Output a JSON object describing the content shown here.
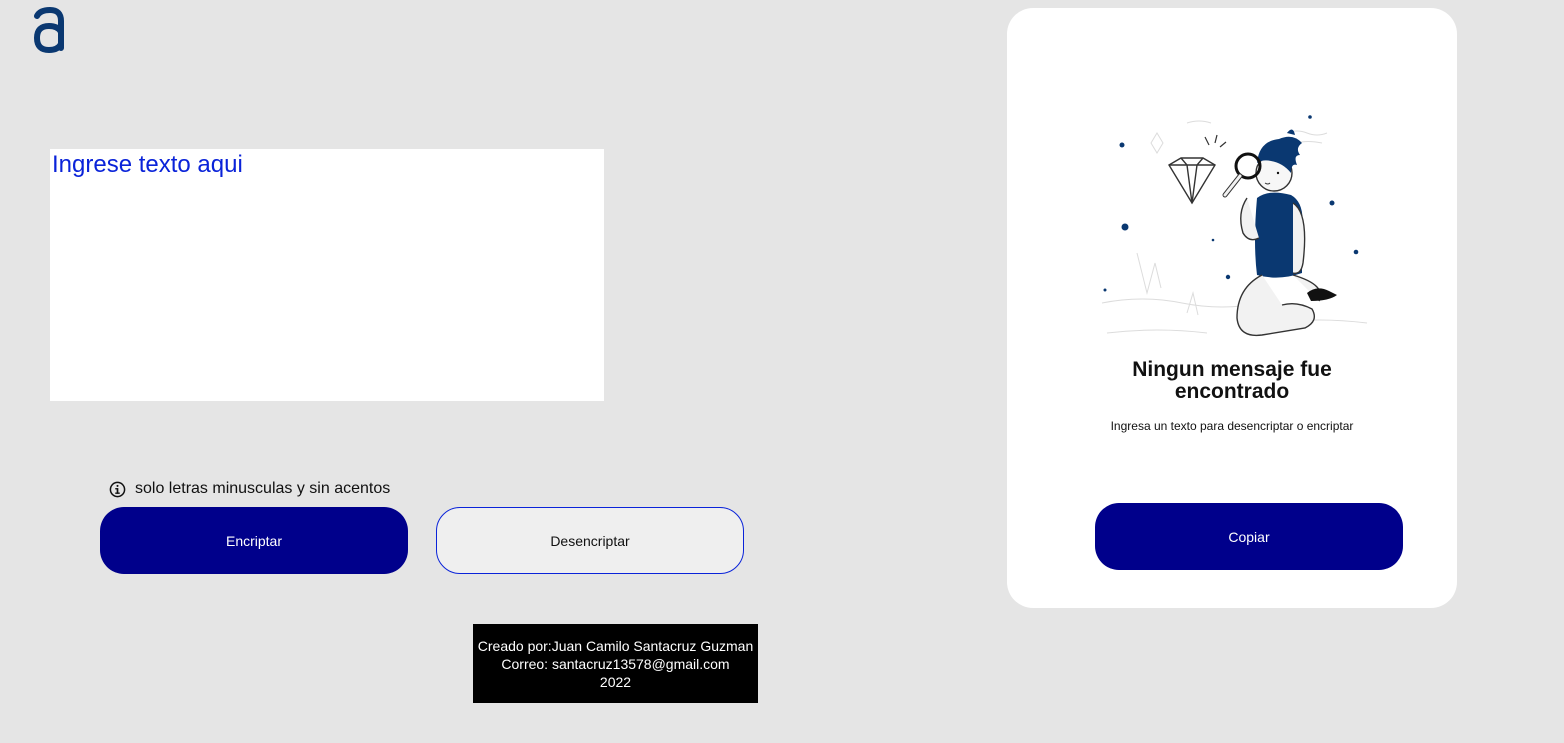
{
  "input": {
    "placeholder": "Ingrese texto aqui"
  },
  "hint": {
    "icon": "info-icon",
    "text": "solo letras minusculas y sin acentos"
  },
  "buttons": {
    "encrypt_label": "Encriptar",
    "decrypt_label": "Desencriptar",
    "copy_label": "Copiar"
  },
  "result_panel": {
    "title_line1": "Ningun mensaje fue",
    "title_line2": "encontrado",
    "subtitle": "Ingresa un texto para desencriptar o encriptar"
  },
  "footer": {
    "line1": "Creado por:Juan Camilo Santacruz Guzman",
    "line2": "Correo: santacruz13578@gmail.com",
    "line3": "2022"
  },
  "colors": {
    "background": "#e5e5e5",
    "primary_button": "#00008b",
    "accent_blue": "#0a23d9",
    "logo": "#0a3871"
  }
}
